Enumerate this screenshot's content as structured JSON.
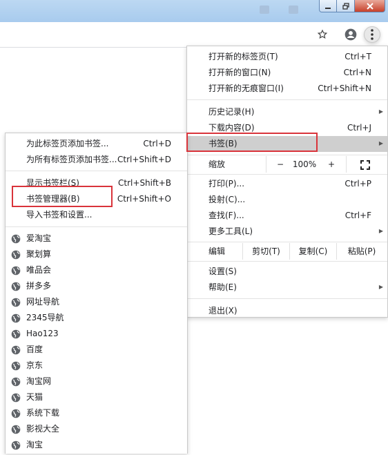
{
  "browser_menu": {
    "items": [
      {
        "label": "打开新的标签页(T)",
        "shortcut": "Ctrl+T"
      },
      {
        "label": "打开新的窗口(N)",
        "shortcut": "Ctrl+N"
      },
      {
        "label": "打开新的无痕窗口(I)",
        "shortcut": "Ctrl+Shift+N"
      },
      {
        "label": "历史记录(H)",
        "shortcut": ""
      },
      {
        "label": "下载内容(D)",
        "shortcut": "Ctrl+J"
      },
      {
        "label": "书签(B)",
        "shortcut": ""
      }
    ],
    "zoom": {
      "label": "缩放",
      "minus": "−",
      "value": "100%",
      "plus": "+"
    },
    "items2": [
      {
        "label": "打印(P)...",
        "shortcut": "Ctrl+P"
      },
      {
        "label": "投射(C)...",
        "shortcut": ""
      },
      {
        "label": "查找(F)...",
        "shortcut": "Ctrl+F"
      },
      {
        "label": "更多工具(L)",
        "shortcut": ""
      }
    ],
    "edit": {
      "label": "编辑",
      "cut": "剪切(T)",
      "copy": "复制(C)",
      "paste": "粘贴(P)"
    },
    "items3": [
      {
        "label": "设置(S)"
      },
      {
        "label": "帮助(E)"
      },
      {
        "label": "退出(X)"
      }
    ]
  },
  "bookmarks_menu": {
    "items": [
      {
        "label": "为此标签页添加书签...",
        "shortcut": "Ctrl+D"
      },
      {
        "label": "为所有标签页添加书签...",
        "shortcut": "Ctrl+Shift+D"
      },
      {
        "label": "显示书签栏(S)",
        "shortcut": "Ctrl+Shift+B"
      },
      {
        "label": "书签管理器(B)",
        "shortcut": "Ctrl+Shift+O"
      },
      {
        "label": "导入书签和设置...",
        "shortcut": ""
      }
    ],
    "bookmarks": [
      "爱淘宝",
      "聚划算",
      "唯品会",
      "拼多多",
      "网址导航",
      "2345导航",
      "Hao123",
      "百度",
      "京东",
      "淘宝网",
      "天猫",
      "系统下载",
      "影视大全",
      "淘宝"
    ]
  },
  "colors": {
    "highlight": "#d9333a",
    "hover": "#cfcfcf"
  },
  "icons": [
    "minimize-icon",
    "restore-icon",
    "close-icon",
    "star-icon",
    "profile-icon",
    "menu-dots-icon",
    "fullscreen-icon",
    "submenu-arrow-icon",
    "globe-icon"
  ]
}
